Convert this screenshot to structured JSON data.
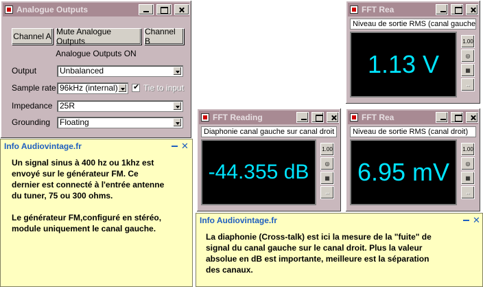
{
  "analogue": {
    "title": "Analogue Outputs",
    "buttons": {
      "channel_a": "Channel A",
      "mute": "Mute Analogue Outputs",
      "channel_b": "Channel B"
    },
    "status": "Analogue Outputs ON",
    "output": {
      "label": "Output",
      "value": "Unbalanced"
    },
    "sample_rate": {
      "label": "Sample rate",
      "value": "96kHz (internal)",
      "tie_label": "Tie to input",
      "tie_checked": true
    },
    "impedance": {
      "label": "Impedance",
      "value": "25R"
    },
    "grounding": {
      "label": "Grounding",
      "value": "Floating"
    }
  },
  "fft_left": {
    "title": "FFT Rea",
    "label": "Niveau de sortie RMS (canal gauche)",
    "value": "1.13 V"
  },
  "fft_cross": {
    "title": "FFT Reading",
    "label": "Diaphonie canal gauche sur canal droit",
    "value": "-44.355 dB"
  },
  "fft_right": {
    "title": "FFT Rea",
    "label": "Niveau de sortie RMS (canal droit)",
    "value": "6.95 mV"
  },
  "side_buttons": {
    "tip": "1.00",
    "arrows": "↔"
  },
  "info1": {
    "title": "Info Audiovintage.fr",
    "para1": [
      "Un signal sinus à 400 hz ou 1khz est",
      "envoyé sur le générateur FM. Ce",
      "dernier est connecté à l'entrée antenne",
      "du tuner, 75 ou 300 ohms."
    ],
    "para2": [
      "Le générateur FM,configuré en stéréo,",
      "module uniquement le canal gauche."
    ]
  },
  "info2": {
    "title": "Info Audiovintage.fr",
    "lines": [
      "La diaphonie (Cross-talk) est ici la mesure de la \"fuite\" de",
      "signal du canal gauche sur le canal droit. Plus la valeur",
      "absolue en dB est importante, meilleure est la séparation",
      "des canaux."
    ]
  },
  "colors": {
    "display_text": "#00e5ff",
    "title_active_start": "#0a246a",
    "title_active_end": "#a6caf0",
    "note_bg": "#ffffc0",
    "note_accent": "#1f5fbf"
  }
}
